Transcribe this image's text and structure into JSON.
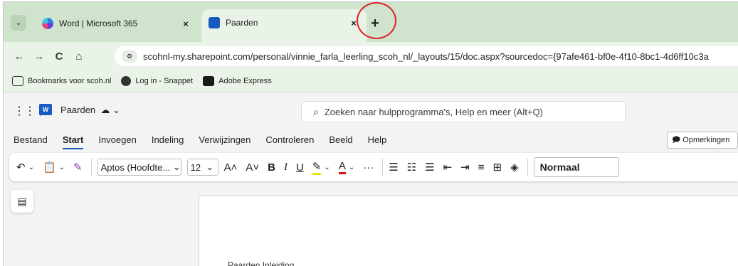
{
  "colors": {
    "tabstrip": "#cfe3cd",
    "word_blue": "#185abd",
    "highlight_circle": "#e0202a"
  },
  "tabs": [
    {
      "label": "Word | Microsoft 365",
      "close": "×"
    },
    {
      "label": "Paarden",
      "close": "×"
    }
  ],
  "new_tab": "+",
  "tab_search_icon": "⌄",
  "nav": {
    "back": "←",
    "forward": "→",
    "reload": "C",
    "home": "⌂"
  },
  "url": "scohnl-my.sharepoint.com/personal/vinnie_farla_leerling_scoh_nl/_layouts/15/doc.aspx?sourcedoc={97afe461-bf0e-4f10-8bc1-4d6ff10c3a",
  "bookmarks": [
    {
      "label": "Bookmarks voor scoh.nl",
      "icon": "bookmark-folder-icon"
    },
    {
      "label": "Log in - Snappet",
      "icon": "snappet-icon"
    },
    {
      "label": "Adobe Express",
      "icon": "adobe-express-icon"
    }
  ],
  "app": {
    "word_logo": "W",
    "doc_title": "Paarden",
    "doc_title_suffix": "⌄"
  },
  "search": {
    "placeholder": "Zoeken naar hulpprogramma's, Help en meer (Alt+Q)"
  },
  "menu": [
    "Bestand",
    "Start",
    "Invoegen",
    "Indeling",
    "Verwijzingen",
    "Controleren",
    "Beeld",
    "Help"
  ],
  "comments_label": "Opmerkingen",
  "ribbon": {
    "font_name": "Aptos (Hoofdte...",
    "font_size": "12",
    "style": "Normaal",
    "grow": "A˄",
    "shrink": "A˅",
    "bold": "B",
    "italic": "I",
    "underline": "U",
    "more": "···"
  },
  "doc_text": "Paarden                  Inleiding"
}
